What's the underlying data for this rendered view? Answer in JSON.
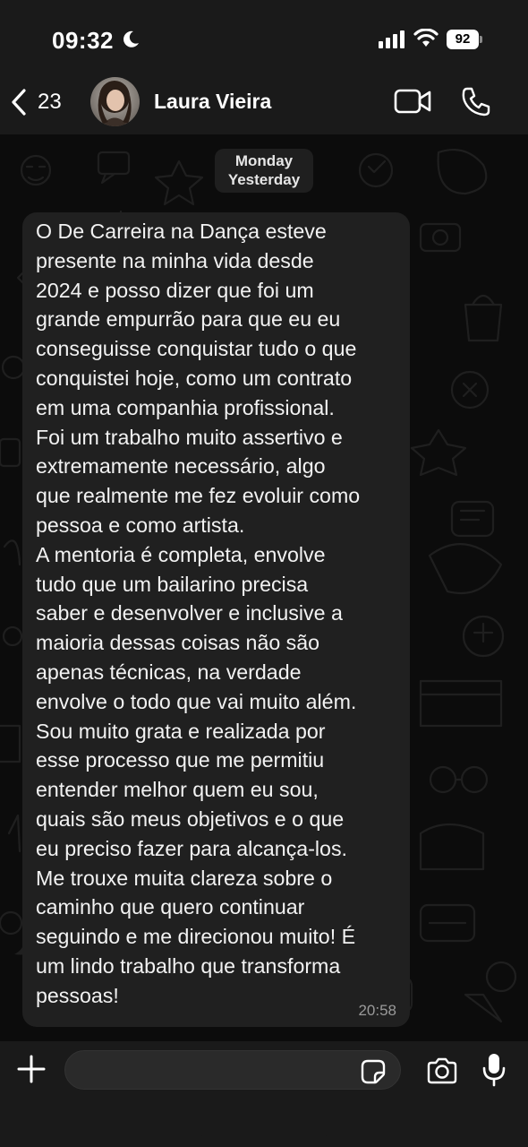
{
  "status_bar": {
    "time": "09:32",
    "battery": "92"
  },
  "header": {
    "back_count": "23",
    "contact_name": "Laura Vieira"
  },
  "chat": {
    "date_day": "Monday",
    "date_relative": "Yesterday",
    "message": {
      "text": "O De Carreira na Dança esteve\npresente na minha vida desde\n2024 e posso dizer que foi um\ngrande empurrão para que eu eu\nconseguisse conquistar tudo o que\nconquistei hoje, como um contrato\nem uma companhia profissional.\nFoi um trabalho muito assertivo e\nextremamente necessário, algo\nque realmente me fez evoluir como\npessoa e como artista.\nA mentoria é completa, envolve\ntudo que um bailarino precisa\nsaber e desenvolver e inclusive a\nmaioria dessas coisas não são\napenas técnicas, na verdade\nenvolve o todo que vai muito além.\nSou muito grata e realizada por\nesse processo que me permitiu\nentender melhor quem eu sou,\nquais são meus objetivos e o que\neu preciso fazer para alcança-los.\nMe trouxe muita clareza sobre o\ncaminho que quero continuar\nseguindo e me direcionou muito! É\num lindo trabalho que transforma\npessoas!",
      "time": "20:58"
    }
  },
  "icons": {
    "back": "chevron-left-icon",
    "video": "video-camera-icon",
    "call": "phone-icon",
    "plus": "plus-icon",
    "sticker": "sticker-icon",
    "camera": "camera-icon",
    "mic": "microphone-icon"
  },
  "colors": {
    "bar_background": "#1a1a1a",
    "chat_background": "#0c0c0c",
    "bubble": "#202020",
    "text": "#f2f2f2",
    "muted": "#9a9a9a"
  }
}
